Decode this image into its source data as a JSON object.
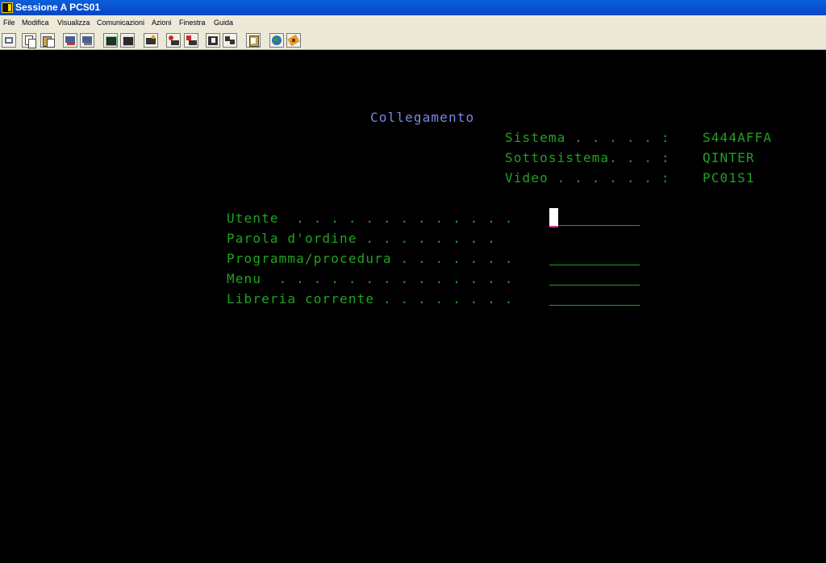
{
  "window": {
    "title": "Sessione A PCS01"
  },
  "menu": [
    "File",
    "Modifica",
    "Visualizza",
    "Comunicazioni",
    "Azioni",
    "Finestra",
    "Guida"
  ],
  "toolbar": {
    "buttons": [
      "print-screen-icon",
      "copy-icon",
      "paste-icon",
      "send-icon",
      "receive-icon",
      "display-icon",
      "keyboard-icon",
      "macro-icon",
      "record-icon",
      "stop-icon",
      "play-icon",
      "transfer-icon",
      "clipboard-icon",
      "globe-icon",
      "help-icon"
    ]
  },
  "screen": {
    "heading": "Collegamento",
    "system_info": [
      {
        "label": "Sistema . . . . . :",
        "value": "S444AFFA"
      },
      {
        "label": "Sottosistema. . . :",
        "value": "QINTER"
      },
      {
        "label": "Video . . . . . . :",
        "value": "PC01S1"
      }
    ],
    "fields": [
      {
        "label": "Utente  . . . . . . . . . . . . .",
        "value": ""
      },
      {
        "label": "Parola d'ordine . . . . . . . .",
        "value": ""
      },
      {
        "label": "Programma/procedura . . . . . . .",
        "value": ""
      },
      {
        "label": "Menu  . . . . . . . . . . . . . .",
        "value": ""
      },
      {
        "label": "Libreria corrente . . . . . . . .",
        "value": ""
      }
    ],
    "text_color": "#1fa31f",
    "heading_color": "#7b86e8"
  }
}
